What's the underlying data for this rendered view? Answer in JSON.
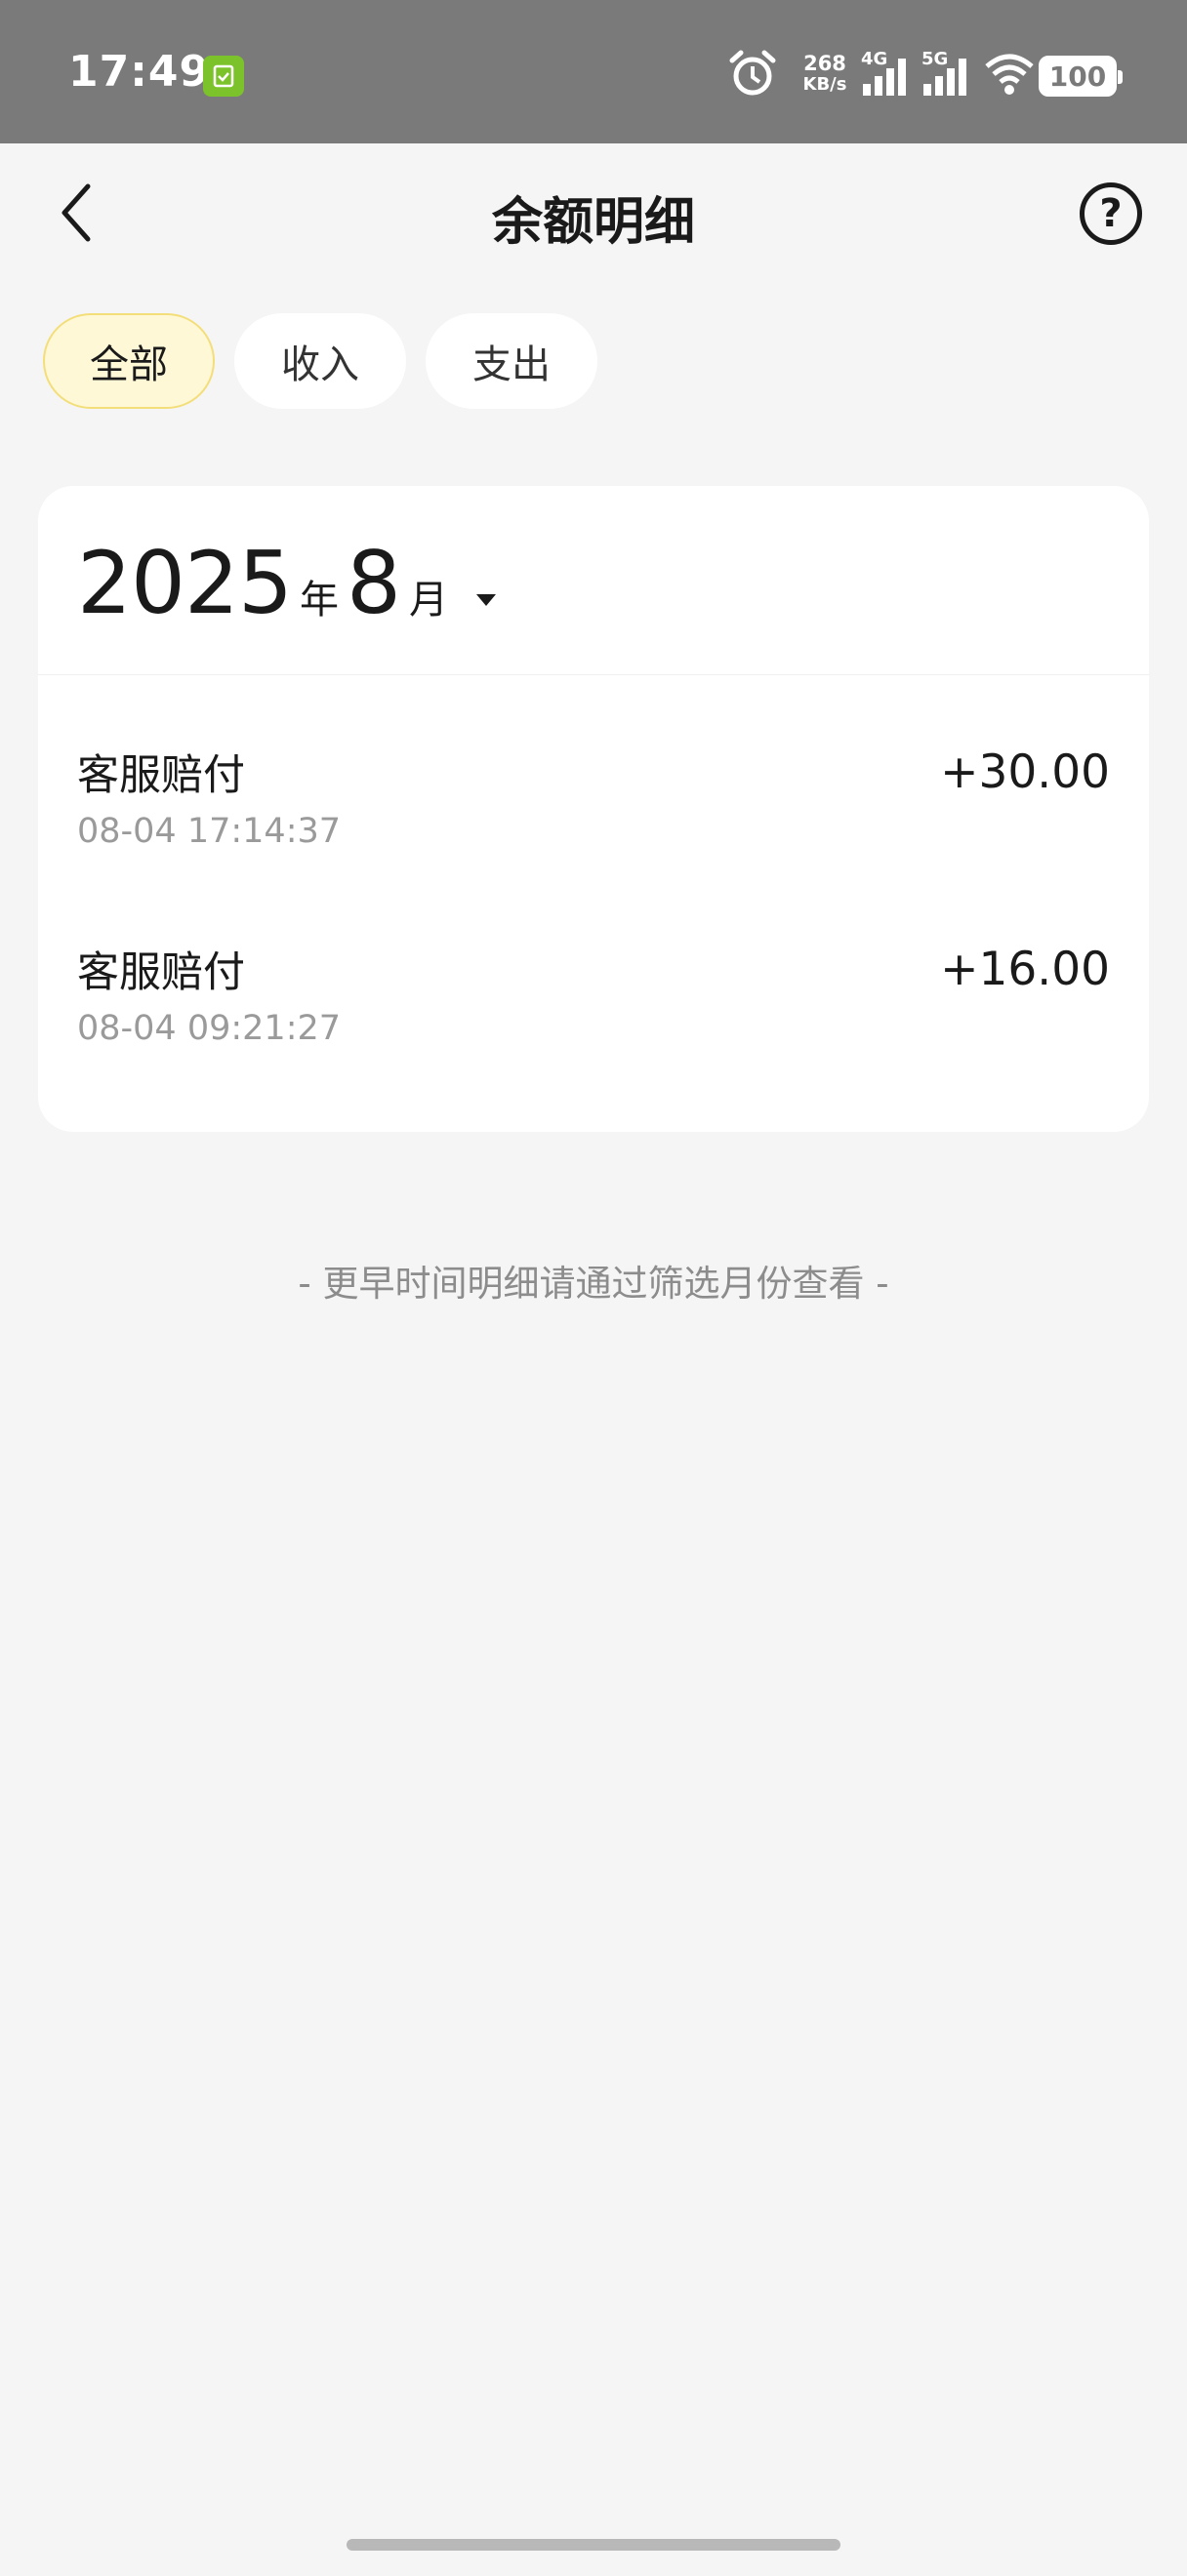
{
  "status_bar": {
    "time": "17:49",
    "net_speed_value": "268",
    "net_speed_unit": "KB/s",
    "signal_1_label": "4G",
    "signal_2_label": "5G",
    "battery": "100"
  },
  "header": {
    "title": "余额明细"
  },
  "filter_tabs": [
    {
      "label": "全部",
      "active": true
    },
    {
      "label": "收入",
      "active": false
    },
    {
      "label": "支出",
      "active": false
    }
  ],
  "month_selector": {
    "year": "2025",
    "year_unit": "年",
    "month": "8",
    "month_unit": "月"
  },
  "transactions": [
    {
      "title": "客服赔付",
      "time": "08-04 17:14:37",
      "amount": "+30.00"
    },
    {
      "title": "客服赔付",
      "time": "08-04 09:21:27",
      "amount": "+16.00"
    }
  ],
  "footer_note": "- 更早时间明细请通过筛选月份查看 -",
  "colors": {
    "status_bar_bg": "#7a7a7a",
    "page_bg": "#f5f5f5",
    "active_tab_bg": "#fff8d6",
    "active_tab_border": "#f3de7a",
    "badge_green": "#7cc22a",
    "secondary_text": "#9a9a9a"
  }
}
